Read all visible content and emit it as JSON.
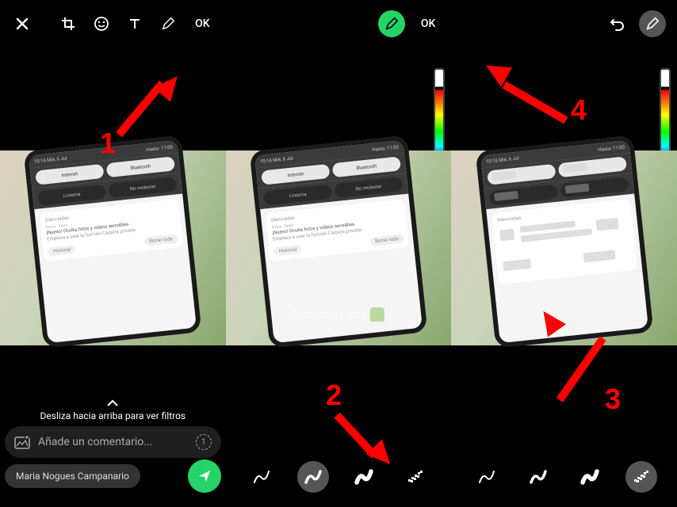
{
  "panel1": {
    "ok_label": "OK",
    "swipe_hint": "Desliza hacia arriba para ver filtros",
    "comment_placeholder": "Añade un comentario...",
    "timer_value": "1",
    "recipient": "Maria Nogues Campanario",
    "annotation_number": "1"
  },
  "panel2": {
    "ok_label": "OK",
    "watermark": "El androide libre",
    "annotation_number": "2"
  },
  "panel3": {
    "annotation_number_a": "3",
    "annotation_number_b": "4"
  },
  "phone": {
    "status_time": "10:16  Mié, 6 Jul",
    "status_right": "Hasta: 11:00",
    "pill_internet": "Internet",
    "pill_bluetooth": "Bluetooth",
    "pill_linterna": "Linterna",
    "pill_nomolestar": "No molestar",
    "card_title": "Silenciadas",
    "card_meta": "Fotos · 3min",
    "card_headline": "¡Nuevo! Oculta fotos y videos sensibles",
    "card_sub": "Empieza a usar la función Carpeta privada",
    "card_btn1": "Historial",
    "card_btn2": "Borrar todo"
  },
  "colors": {
    "accent": "#25D366",
    "annotation": "#ff0000"
  }
}
